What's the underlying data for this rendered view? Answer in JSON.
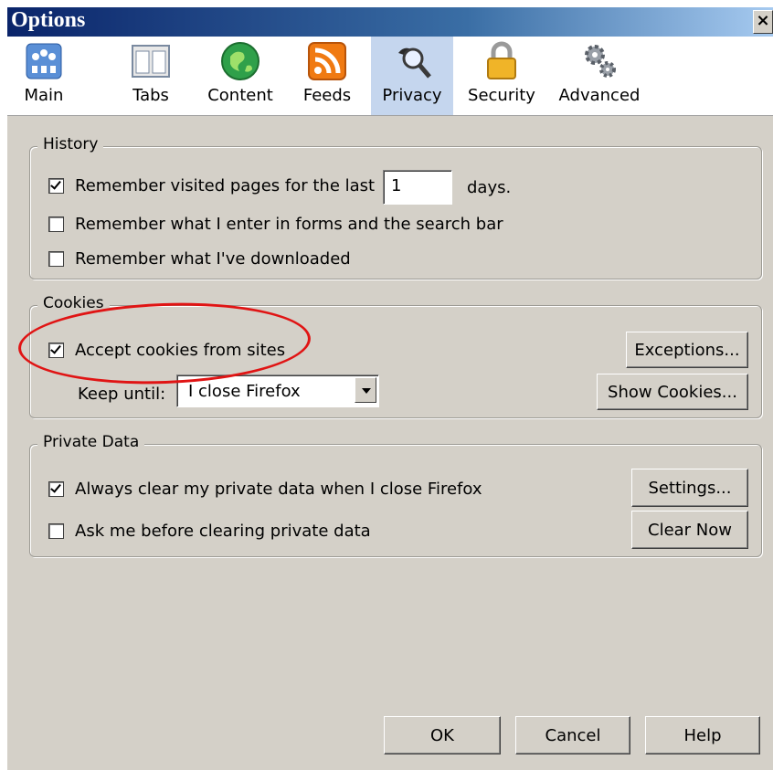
{
  "window": {
    "title": "Options",
    "close_label": "×"
  },
  "toolbar": {
    "items": [
      {
        "label": "Main",
        "icon": "main-icon"
      },
      {
        "label": "Tabs",
        "icon": "tabs-icon"
      },
      {
        "label": "Content",
        "icon": "content-icon"
      },
      {
        "label": "Feeds",
        "icon": "feeds-icon"
      },
      {
        "label": "Privacy",
        "icon": "privacy-icon",
        "selected": true
      },
      {
        "label": "Security",
        "icon": "security-icon"
      },
      {
        "label": "Advanced",
        "icon": "advanced-icon"
      }
    ]
  },
  "history": {
    "legend": "History",
    "visited_label": "Remember visited pages for the last",
    "visited_checked": true,
    "days_value": "1",
    "days_suffix": "days.",
    "forms_label": "Remember what I enter in forms and the search bar",
    "forms_checked": false,
    "downloads_label": "Remember what I've downloaded",
    "downloads_checked": false
  },
  "cookies": {
    "legend": "Cookies",
    "accept_label": "Accept cookies from sites",
    "accept_checked": true,
    "keep_until_label": "Keep until:",
    "keep_until_value": "I close Firefox",
    "exceptions_label": "Exceptions...",
    "show_cookies_label": "Show Cookies..."
  },
  "private_data": {
    "legend": "Private Data",
    "always_clear_label": "Always clear my private data when I close Firefox",
    "always_clear_checked": true,
    "ask_label": "Ask me before clearing private data",
    "ask_checked": false,
    "settings_label": "Settings...",
    "clear_now_label": "Clear Now"
  },
  "footer": {
    "ok_label": "OK",
    "cancel_label": "Cancel",
    "help_label": "Help"
  },
  "colors": {
    "dialog_bg": "#d4d0c8",
    "titlebar": "#0a246a",
    "selected_tab": "#c5d6ee",
    "annotation": "#e01414"
  }
}
